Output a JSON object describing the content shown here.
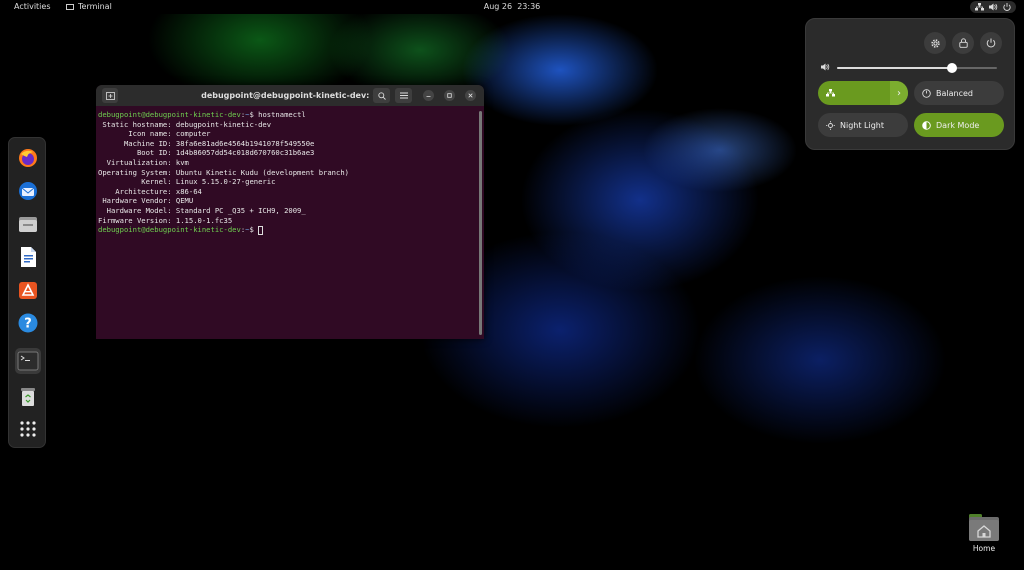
{
  "topbar": {
    "activities": "Activities",
    "app_name": "Terminal",
    "date": "Aug 26",
    "time": "23:36",
    "tray_icons": [
      "network-icon",
      "volume-icon",
      "power-icon"
    ]
  },
  "dock": {
    "items": [
      {
        "name": "Firefox",
        "icon": "firefox-icon"
      },
      {
        "name": "Thunderbird",
        "icon": "thunderbird-icon"
      },
      {
        "name": "Files",
        "icon": "files-icon"
      },
      {
        "name": "LibreOffice Writer",
        "icon": "writer-icon"
      },
      {
        "name": "Ubuntu Software",
        "icon": "software-store-icon"
      },
      {
        "name": "Help",
        "icon": "help-icon"
      },
      {
        "name": "Terminal",
        "icon": "terminal-icon"
      },
      {
        "name": "Trash",
        "icon": "trash-icon"
      },
      {
        "name": "Show Applications",
        "icon": "app-grid-icon"
      }
    ]
  },
  "terminal": {
    "title": "debugpoint@debugpoint-kinetic-dev: ~",
    "prompt_user": "debugpoint@debugpoint-kinetic-dev",
    "prompt_path": "~",
    "prompt_sep": ":",
    "prompt_dollar": "$ ",
    "command": "hostnamectl",
    "output": [
      " Static hostname: debugpoint-kinetic-dev",
      "       Icon name: computer",
      "      Machine ID: 38fa6e81ad6e4564b1941078f549550e",
      "         Boot ID: 1d4b86057dd54c018d670760c31b6ae3",
      "  Virtualization: kvm",
      "Operating System: Ubuntu Kinetic Kudu (development branch)",
      "          Kernel: Linux 5.15.0-27-generic",
      "    Architecture: x86-64",
      " Hardware Vendor: QEMU",
      "  Hardware Model: Standard PC _Q35 + ICH9, 2009_",
      "Firmware Version: 1.15.0-1.fc35"
    ]
  },
  "quick_settings": {
    "volume_level": 0.72,
    "power_mode_label": "Balanced",
    "night_light_label": "Night Light",
    "dark_mode_label": "Dark Mode",
    "network_expand_glyph": "›",
    "colors": {
      "accent": "#6a9a1f",
      "panel": "#2b2b2b"
    }
  },
  "desktop": {
    "home_label": "Home"
  }
}
